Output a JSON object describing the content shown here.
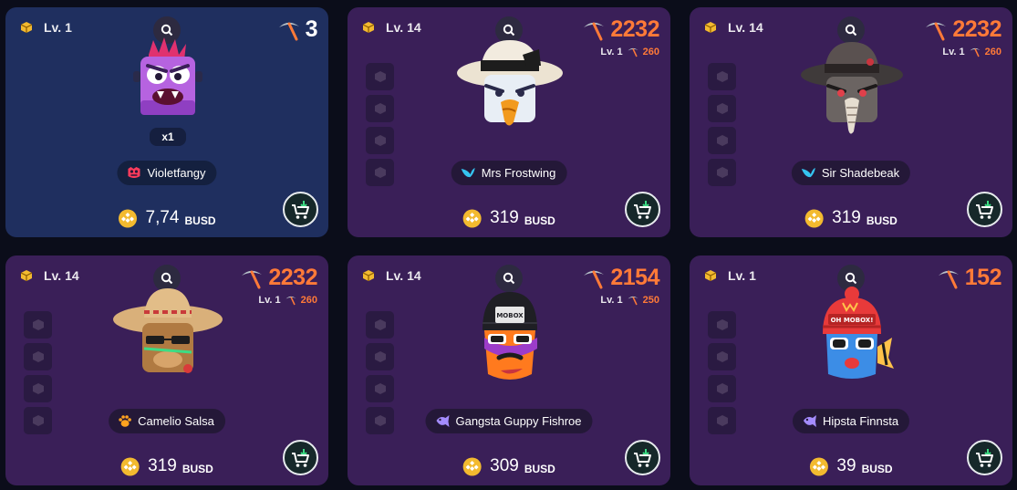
{
  "colors": {
    "card_purple": "#3a1f58",
    "card_blue": "#1f2f5f",
    "power_orange": "#ff7a38",
    "coin_gold": "#f3ba2f",
    "cart_green": "#3ddc84"
  },
  "cards": [
    {
      "level": "Lv. 1",
      "power": "3",
      "quantity": "x1",
      "name": "Violetfangy",
      "price": "7,74",
      "currency": "BUSD",
      "style": "blue",
      "species_icon": "monster-face-icon",
      "art": "violet-cube-monster"
    },
    {
      "level": "Lv. 14",
      "power": "2232",
      "sub_level": "Lv. 1",
      "sub_power": "260",
      "name": "Mrs Frostwing",
      "price": "319",
      "currency": "BUSD",
      "style": "purple",
      "species_icon": "bird-icon",
      "art": "white-hat-bird"
    },
    {
      "level": "Lv. 14",
      "power": "2232",
      "sub_level": "Lv. 1",
      "sub_power": "260",
      "name": "Sir Shadebeak",
      "price": "319",
      "currency": "BUSD",
      "style": "purple",
      "species_icon": "bird-icon",
      "art": "fedora-dark-bird"
    },
    {
      "level": "Lv. 14",
      "power": "2232",
      "sub_level": "Lv. 1",
      "sub_power": "260",
      "name": "Camelio Salsa",
      "price": "319",
      "currency": "BUSD",
      "style": "purple",
      "species_icon": "paw-icon",
      "art": "sombrero-camel"
    },
    {
      "level": "Lv. 14",
      "power": "2154",
      "sub_level": "Lv. 1",
      "sub_power": "250",
      "name": "Gangsta Guppy Fishroe",
      "price": "309",
      "currency": "BUSD",
      "style": "purple",
      "species_icon": "fish-icon",
      "art": "beanie-fish",
      "beanie_text": "MOBOX"
    },
    {
      "level": "Lv. 1",
      "power": "152",
      "name": "Hipsta Finnsta",
      "price": "39",
      "currency": "BUSD",
      "style": "purple",
      "species_icon": "fish-icon",
      "art": "red-beanie-fish",
      "beanie_text": "OH MOBOX!"
    }
  ]
}
